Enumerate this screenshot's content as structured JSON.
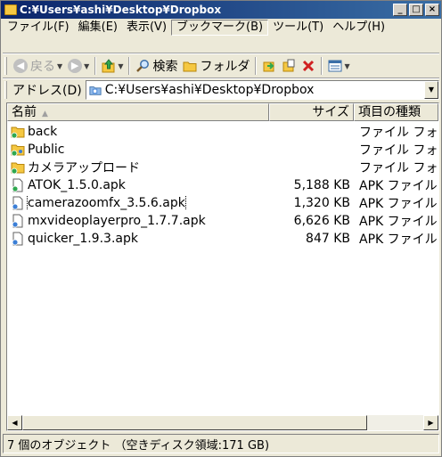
{
  "window": {
    "title": "C:¥Users¥ashi¥Desktop¥Dropbox",
    "minimize": "_",
    "maximize": "□",
    "close": "×"
  },
  "menu": [
    {
      "label": "ファイル(F)"
    },
    {
      "label": "編集(E)"
    },
    {
      "label": "表示(V)"
    },
    {
      "label": "ブックマーク(B)"
    },
    {
      "label": "ツール(T)"
    },
    {
      "label": "ヘルプ(H)"
    }
  ],
  "toolbar": {
    "back_label": "戻る",
    "search_label": "検索",
    "folder_label": "フォルダ"
  },
  "address": {
    "label": "アドレス(D)",
    "value": "C:¥Users¥ashi¥Desktop¥Dropbox"
  },
  "columns": {
    "name": "名前",
    "size": "サイズ",
    "type": "項目の種類"
  },
  "files": [
    {
      "name": "back",
      "size": "",
      "type": "ファイル フォルダ",
      "kind": "folder"
    },
    {
      "name": "Public",
      "size": "",
      "type": "ファイル フォルダ",
      "kind": "folder-shared"
    },
    {
      "name": "カメラアップロード",
      "size": "",
      "type": "ファイル フォルダ",
      "kind": "folder"
    },
    {
      "name": "ATOK_1.5.0.apk",
      "size": "5,188 KB",
      "type": "APK ファイル",
      "kind": "apk-synced"
    },
    {
      "name": "camerazoomfx_3.5.6.apk",
      "size": "1,320 KB",
      "type": "APK ファイル",
      "kind": "apk"
    },
    {
      "name": "mxvideoplayerpro_1.7.7.apk",
      "size": "6,626 KB",
      "type": "APK ファイル",
      "kind": "apk"
    },
    {
      "name": "quicker_1.9.3.apk",
      "size": "847 KB",
      "type": "APK ファイル",
      "kind": "apk"
    }
  ],
  "status": {
    "text": "7 個のオブジェクト （空きディスク領域:171 GB)"
  },
  "colors": {
    "titlebar": "#0a246a",
    "face": "#ece9d8",
    "folder": "#f5c842",
    "sync_green": "#2fa84f",
    "sync_blue": "#3c7fd6"
  }
}
